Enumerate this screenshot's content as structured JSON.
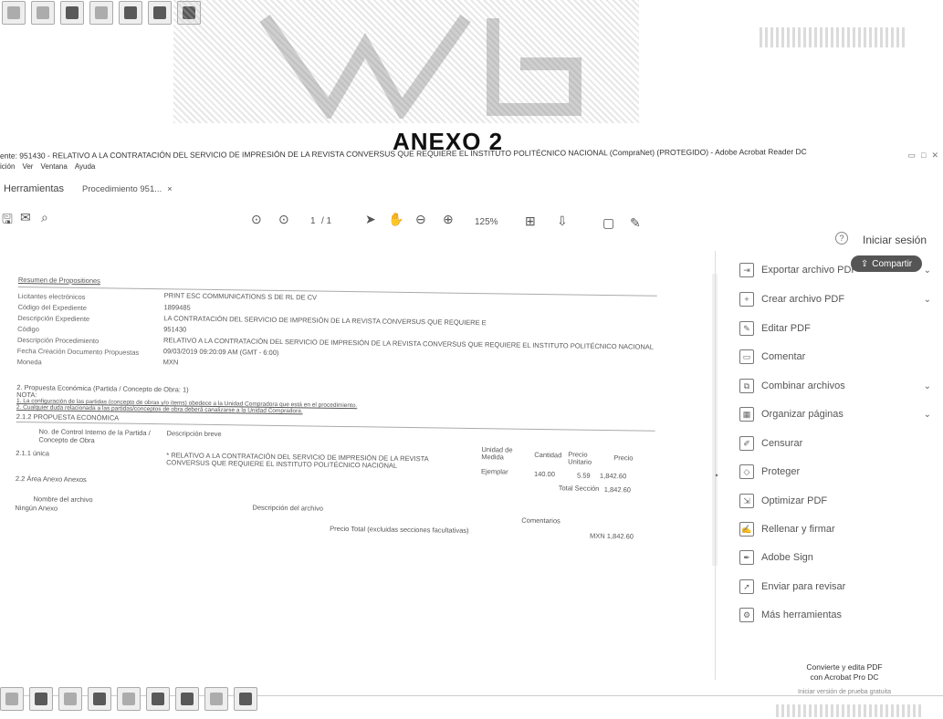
{
  "anexo_title": "ANEXO 2",
  "window_title": "ente: 951430 - RELATIVO A LA CONTRATACIÓN DEL SERVICIO DE IMPRESIÓN DE LA REVISTA CONVERSUS QUE REQUIERE EL INSTITUTO POLITÉCNICO NACIONAL (CompraNet) (PROTEGIDO) - Adobe Acrobat Reader DC",
  "menu": [
    "ición",
    "Ver",
    "Ventana",
    "Ayuda"
  ],
  "tabs": {
    "tools": "Herramientas",
    "document": "Procedimiento 951...",
    "close": "×"
  },
  "toolbar": {
    "page_current": "1",
    "page_total": "/ 1",
    "zoom": "125%"
  },
  "signin": "Iniciar sesión",
  "share": "Compartir",
  "document": {
    "section_title": "Resumen de Propositiones",
    "fields": [
      {
        "label": "Licitantes electrónicos",
        "value": "PRINT ESC COMMUNICATIONS S DE RL DE CV"
      },
      {
        "label": "Código del Expediente",
        "value": "1899485"
      },
      {
        "label": "Descripción Expediente",
        "value": "LA CONTRATACIÓN DEL SERVICIO DE IMPRESIÓN DE LA REVISTA CONVERSUS QUE REQUIERE E"
      },
      {
        "label": "Código",
        "value": "951430"
      },
      {
        "label": "Descripción Procedimiento",
        "value": "RELATIVO A LA CONTRATACIÓN DEL SERVICIO DE IMPRESIÓN DE LA REVISTA CONVERSUS QUE REQUIERE EL INSTITUTO POLITÉCNICO NACIONAL"
      },
      {
        "label": "Fecha Creación Documento Propuestas",
        "value": "09/03/2019 09:20:09 AM (GMT - 6:00)"
      },
      {
        "label": "Moneda",
        "value": "MXN"
      }
    ],
    "proposal_heading": "2. Propuesta Económica (Partida / Concepto de Obra: 1)",
    "nota": "NOTA:",
    "nota_1": "1. La configuración de las partidas (concepto de obras y/o ítems) obedece a la Unidad Compradora que está en el procedimiento.",
    "nota_2": "2. Cualquier duda relacionada a las partidas/conceptos de obra deberá canalizarse a la Unidad Compradora.",
    "sub_heading": "2.1.2 PROPUESTA ECONÓMICA",
    "table_headers": {
      "control": "No. de Control Interno de la Partida / Concepto de Obra",
      "desc": "Descripción breve",
      "unit": "Unidad de Medida",
      "qty": "Cantidad",
      "unit_price": "Precio Unitario",
      "price": "Precio"
    },
    "row": {
      "id": "2.1.1 única",
      "desc": "* RELATIVO A LA CONTRATACIÓN DEL SERVICIO DE IMPRESIÓN DE LA REVISTA CONVERSUS QUE REQUIERE EL INSTITUTO POLITÉCNICO NACIONAL",
      "unit": "Ejemplar",
      "qty": "140.00",
      "unit_price": "5.59",
      "price": "1,842.60"
    },
    "total_label": "Total Sección",
    "total_value": "1,842.60",
    "attach_heading": "2.2 Área Anexo Anexos",
    "attach_name_header": "Nombre del archivo",
    "attach_name": "Ningún Anexo",
    "attach_desc_header": "Descripción del archivo",
    "attach_comments_header": "Comentarios",
    "grand_total_label": "Precio Total (excluidas secciones facultativas)",
    "grand_total_value": "MXN 1,842.60"
  },
  "tools_panel": [
    {
      "label": "Exportar archivo PDF",
      "icon": "export-pdf-icon",
      "chevron": true
    },
    {
      "label": "Crear archivo PDF",
      "icon": "create-pdf-icon",
      "chevron": true
    },
    {
      "label": "Editar PDF",
      "icon": "edit-pdf-icon",
      "chevron": false
    },
    {
      "label": "Comentar",
      "icon": "comment-icon",
      "chevron": false
    },
    {
      "label": "Combinar archivos",
      "icon": "combine-files-icon",
      "chevron": true
    },
    {
      "label": "Organizar páginas",
      "icon": "organize-pages-icon",
      "chevron": true
    },
    {
      "label": "Censurar",
      "icon": "redact-icon",
      "chevron": false
    },
    {
      "label": "Proteger",
      "icon": "protect-icon",
      "chevron": false
    },
    {
      "label": "Optimizar PDF",
      "icon": "optimize-pdf-icon",
      "chevron": false
    },
    {
      "label": "Rellenar y firmar",
      "icon": "fill-sign-icon",
      "chevron": false
    },
    {
      "label": "Adobe Sign",
      "icon": "adobe-sign-icon",
      "chevron": false
    },
    {
      "label": "Enviar para revisar",
      "icon": "send-review-icon",
      "chevron": false
    },
    {
      "label": "Más herramientas",
      "icon": "more-tools-icon",
      "chevron": false
    }
  ],
  "promo": {
    "line1": "Convierte y edita PDF",
    "line2": "con Acrobat Pro DC",
    "link": "Iniciar versión de prueba gratuita"
  }
}
